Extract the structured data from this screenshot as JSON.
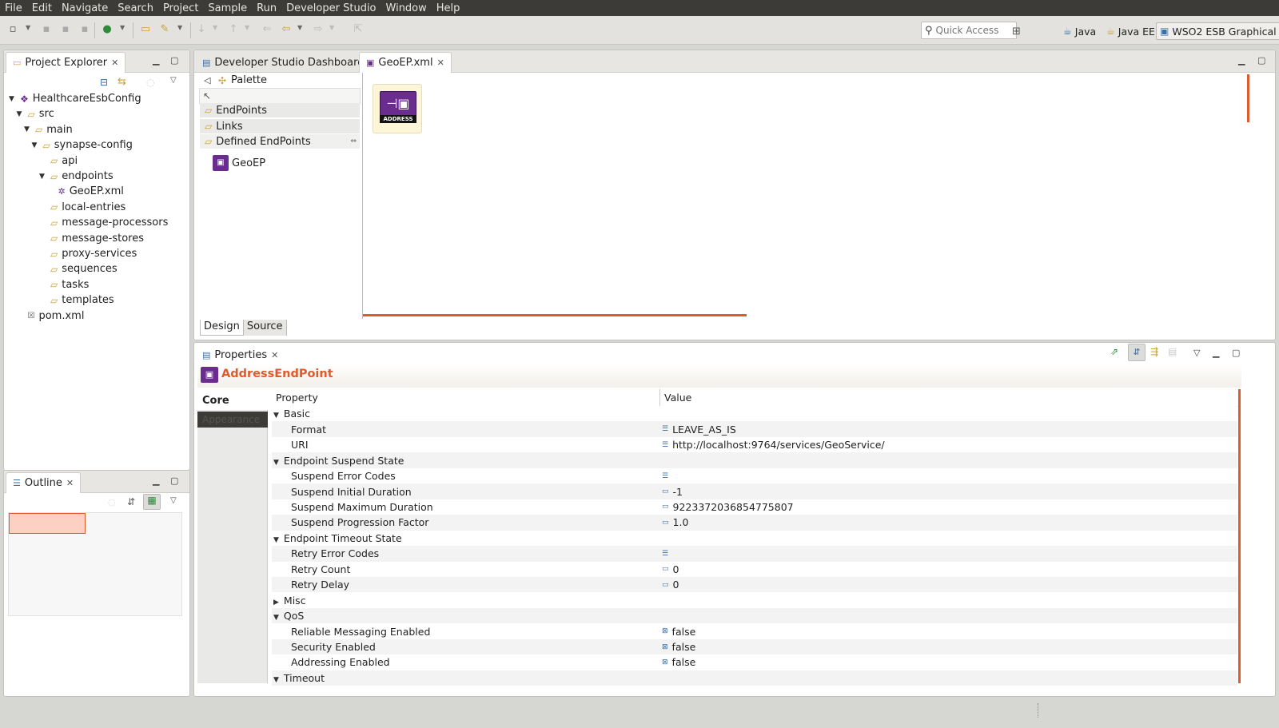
{
  "menubar": [
    "File",
    "Edit",
    "Navigate",
    "Search",
    "Project",
    "Sample",
    "Run",
    "Developer Studio",
    "Window",
    "Help"
  ],
  "toolbar": {
    "quick_access_placeholder": "Quick Access",
    "perspectives": [
      {
        "label": "Java",
        "icon": "java-perspective-icon"
      },
      {
        "label": "Java EE",
        "icon": "javaee-perspective-icon"
      },
      {
        "label": "WSO2 ESB Graphical",
        "icon": "esb-perspective-icon"
      }
    ]
  },
  "project_explorer": {
    "title": "Project Explorer",
    "tree": [
      {
        "label": "HealthcareEsbConfig",
        "depth": 0,
        "expanded": true,
        "icon": "project-icon"
      },
      {
        "label": "src",
        "depth": 1,
        "expanded": true,
        "icon": "folder-icon"
      },
      {
        "label": "main",
        "depth": 2,
        "expanded": true,
        "icon": "folder-icon"
      },
      {
        "label": "synapse-config",
        "depth": 3,
        "expanded": true,
        "icon": "folder-icon"
      },
      {
        "label": "api",
        "depth": 4,
        "icon": "folder-icon"
      },
      {
        "label": "endpoints",
        "depth": 4,
        "expanded": true,
        "icon": "folder-icon"
      },
      {
        "label": "GeoEP.xml",
        "depth": 5,
        "icon": "endpoint-file-icon"
      },
      {
        "label": "local-entries",
        "depth": 4,
        "icon": "folder-icon"
      },
      {
        "label": "message-processors",
        "depth": 4,
        "icon": "folder-icon"
      },
      {
        "label": "message-stores",
        "depth": 4,
        "icon": "folder-icon"
      },
      {
        "label": "proxy-services",
        "depth": 4,
        "icon": "folder-icon"
      },
      {
        "label": "sequences",
        "depth": 4,
        "icon": "folder-icon"
      },
      {
        "label": "tasks",
        "depth": 4,
        "icon": "folder-icon"
      },
      {
        "label": "templates",
        "depth": 4,
        "icon": "folder-icon"
      },
      {
        "label": "pom.xml",
        "depth": 1,
        "icon": "xml-file-icon"
      }
    ]
  },
  "outline": {
    "title": "Outline"
  },
  "editor": {
    "tabs": [
      {
        "label": "Developer Studio Dashboard",
        "active": false
      },
      {
        "label": "GeoEP.xml",
        "active": true
      }
    ],
    "palette": {
      "title": "Palette",
      "sections": [
        "EndPoints",
        "Links",
        "Defined EndPoints"
      ],
      "defined_item": "GeoEP"
    },
    "node_label": "ADDRESS",
    "bottom_tabs": [
      "Design",
      "Source"
    ]
  },
  "properties": {
    "title": "Properties",
    "element_title": "AddressEndPoint",
    "side_tabs": [
      "Core",
      "Appearance"
    ],
    "columns": [
      "Property",
      "Value"
    ],
    "rows": [
      {
        "name": "Basic",
        "group": true,
        "expanded": true
      },
      {
        "name": "Format",
        "value": "LEAVE_AS_IS"
      },
      {
        "name": "URI",
        "value": "http://localhost:9764/services/GeoService/"
      },
      {
        "name": "Endpoint Suspend State",
        "group": true,
        "expanded": true
      },
      {
        "name": "Suspend Error Codes",
        "value": ""
      },
      {
        "name": "Suspend Initial Duration",
        "value": "-1"
      },
      {
        "name": "Suspend Maximum Duration",
        "value": "9223372036854775807"
      },
      {
        "name": "Suspend Progression Factor",
        "value": "1.0"
      },
      {
        "name": "Endpoint Timeout State",
        "group": true,
        "expanded": true
      },
      {
        "name": "Retry Error Codes",
        "value": ""
      },
      {
        "name": "Retry Count",
        "value": "0"
      },
      {
        "name": "Retry Delay",
        "value": "0"
      },
      {
        "name": "Misc",
        "group": true,
        "expanded": false
      },
      {
        "name": "QoS",
        "group": true,
        "expanded": true
      },
      {
        "name": "Reliable Messaging Enabled",
        "value": "false"
      },
      {
        "name": "Security Enabled",
        "value": "false"
      },
      {
        "name": "Addressing Enabled",
        "value": "false"
      },
      {
        "name": "Timeout",
        "group": true,
        "expanded": true
      }
    ]
  },
  "colors": {
    "menubar_bg": "#3c3b37",
    "accent": "#e05a2b",
    "node_purple": "#6a2d8f"
  }
}
